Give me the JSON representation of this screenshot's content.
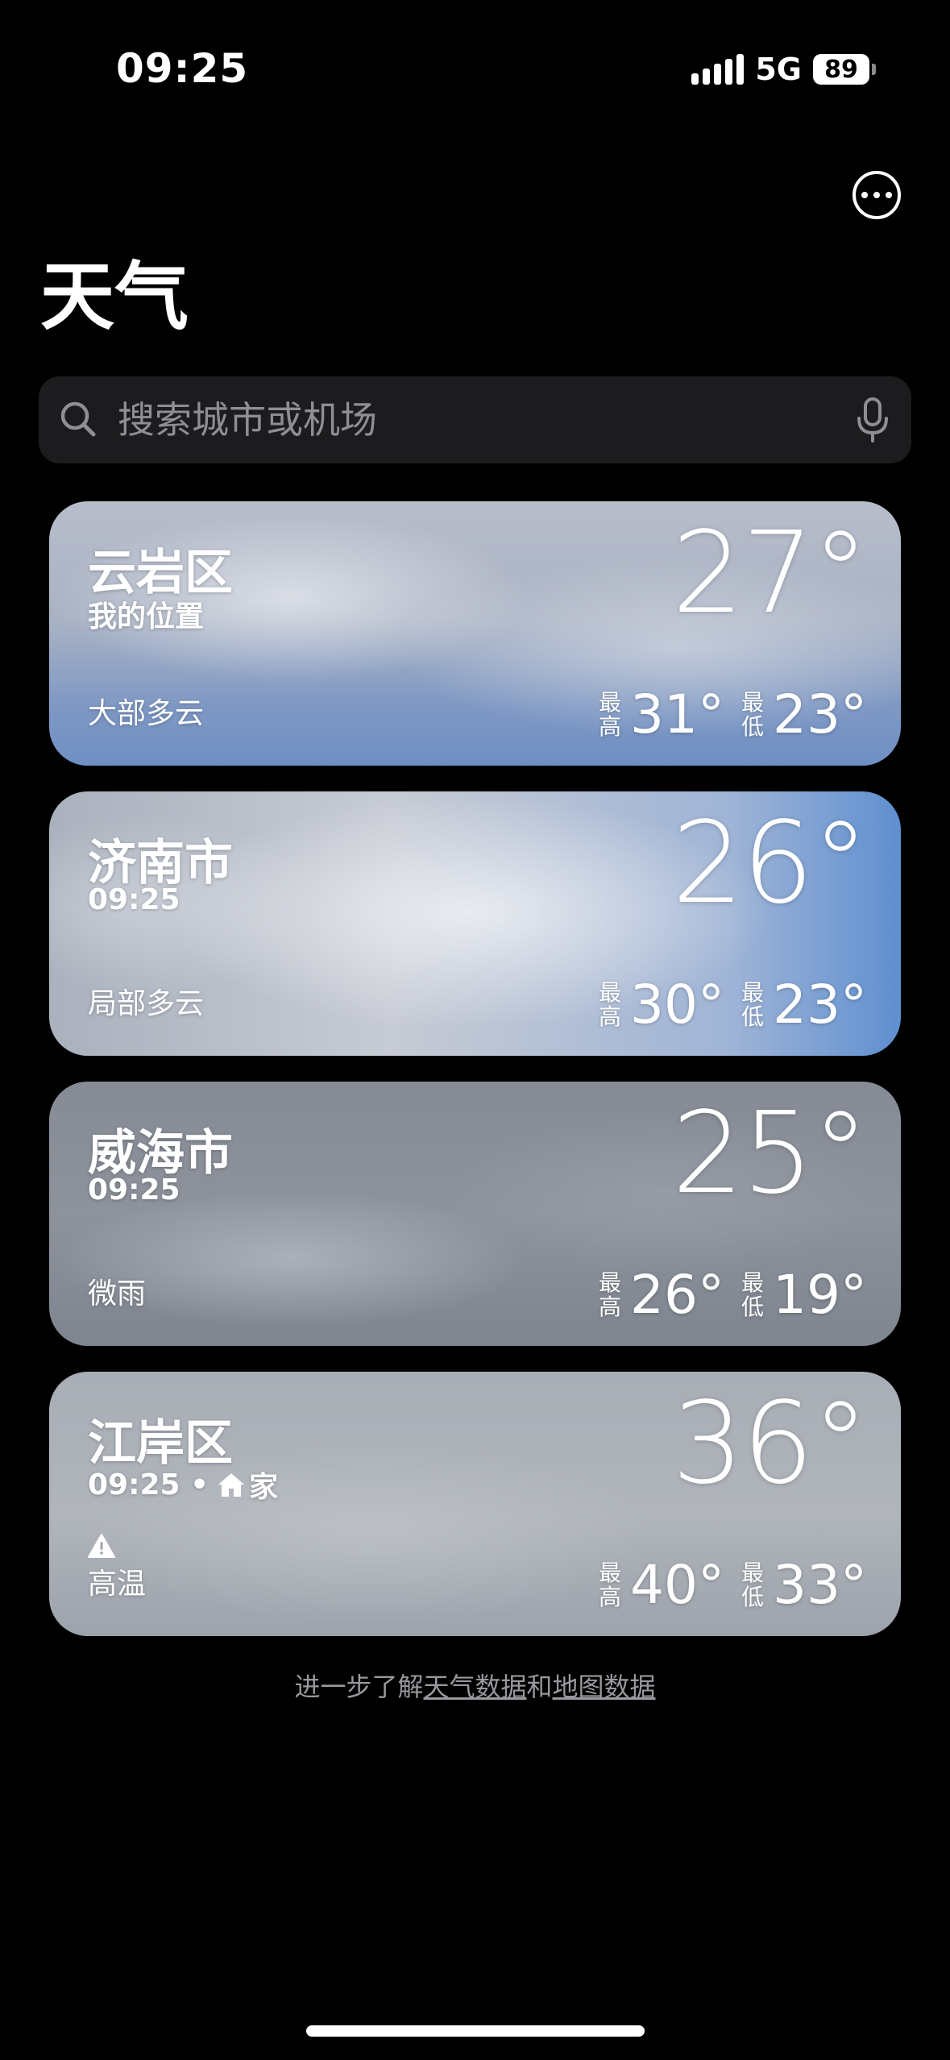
{
  "status_bar": {
    "time": "09:25",
    "network": "5G",
    "battery": "89"
  },
  "header": {
    "title": "天气"
  },
  "search": {
    "placeholder": "搜索城市或机场"
  },
  "cities": [
    {
      "name": "云岩区",
      "subtitle": "我的位置",
      "temperature": "27°",
      "condition": "大部多云",
      "high_label": "最高",
      "high": "31°",
      "low_label": "最低",
      "low": "23°"
    },
    {
      "name": "济南市",
      "subtitle": "09:25",
      "temperature": "26°",
      "condition": "局部多云",
      "high_label": "最高",
      "high": "30°",
      "low_label": "最低",
      "low": "23°"
    },
    {
      "name": "威海市",
      "subtitle": "09:25",
      "temperature": "25°",
      "condition": "微雨",
      "high_label": "最高",
      "high": "26°",
      "low_label": "最低",
      "low": "19°"
    },
    {
      "name": "江岸区",
      "subtitle": "09:25 •",
      "home_label": "家",
      "temperature": "36°",
      "condition": "高温",
      "high_label": "最高",
      "high": "40°",
      "low_label": "最低",
      "low": "33°"
    }
  ],
  "footer": {
    "prefix": "进一步了解",
    "link_weather": "天气数据",
    "connector": "和",
    "link_map": "地图数据"
  },
  "colors": {
    "background": "#000000",
    "search_bg": "#1c1c1e",
    "placeholder": "#8e8e93",
    "footer_text": "#98989e"
  }
}
